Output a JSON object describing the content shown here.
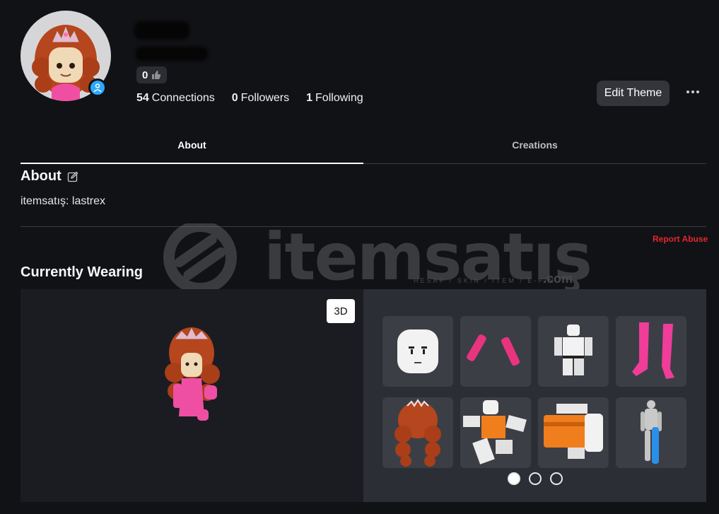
{
  "profile": {
    "likes_count": "0",
    "stats": [
      {
        "count": "54",
        "label": "Connections"
      },
      {
        "count": "0",
        "label": "Followers"
      },
      {
        "count": "1",
        "label": "Following"
      }
    ],
    "edit_theme_label": "Edit Theme"
  },
  "tabs": [
    {
      "label": "About",
      "active": true
    },
    {
      "label": "Creations",
      "active": false
    }
  ],
  "about": {
    "title": "About",
    "description": "itemsatış: lastrex"
  },
  "report_abuse": "Report Abuse",
  "watermark": {
    "text": "itemsatış",
    "subtitle": "HESAP / SKIN / ITEM / E-PIN",
    "suffix": ".com"
  },
  "wearing": {
    "title": "Currently Wearing",
    "view_mode_label": "3D",
    "items": [
      {
        "icon": "face-icon"
      },
      {
        "icon": "pink-arms-icon"
      },
      {
        "icon": "white-body-icon"
      },
      {
        "icon": "pink-legs-icon"
      },
      {
        "icon": "red-hair-icon"
      },
      {
        "icon": "orange-outfit-icon"
      },
      {
        "icon": "orange-torso-icon"
      },
      {
        "icon": "blue-leg-icon"
      }
    ],
    "pages": 3,
    "current_page": 1
  },
  "colors": {
    "background": "#111216",
    "accent_report": "#e3262f",
    "presence": "#2ea8ff"
  }
}
